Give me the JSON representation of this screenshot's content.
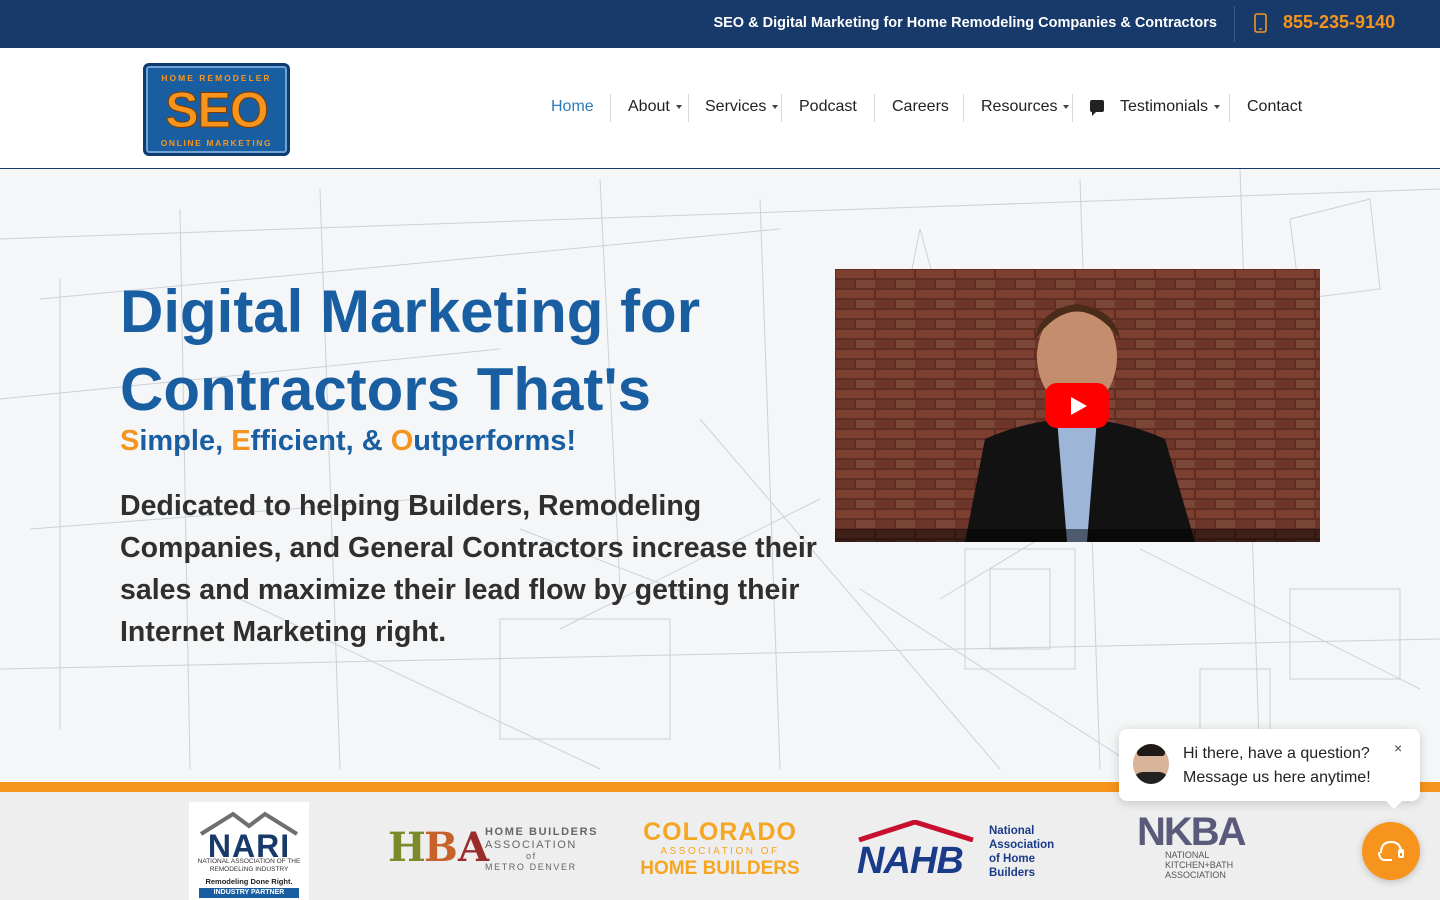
{
  "topbar": {
    "tagline": "SEO & Digital Marketing for Home Remodeling Companies & Contractors",
    "phone": "855-235-9140",
    "phone_icon": "mobile-phone-icon"
  },
  "logo": {
    "top_text": "HOME REMODELER",
    "big_text": "SEO",
    "bottom_text": "ONLINE MARKETING"
  },
  "nav": {
    "items": [
      {
        "label": "Home",
        "active": true,
        "dropdown": false
      },
      {
        "label": "About",
        "dropdown": true
      },
      {
        "label": "Services",
        "dropdown": true
      },
      {
        "label": "Podcast",
        "dropdown": false
      },
      {
        "label": "Careers",
        "dropdown": false
      },
      {
        "label": "Resources",
        "dropdown": true
      },
      {
        "label": "Testimonials",
        "dropdown": true,
        "icon": "chat-bubble-icon"
      },
      {
        "label": "Contact",
        "dropdown": false
      }
    ]
  },
  "hero": {
    "heading": "Digital Marketing for Contractors That's",
    "tagline_parts": [
      "S",
      "imple, ",
      "E",
      "fficient, & ",
      "O",
      "utperforms!"
    ],
    "description": "Dedicated to helping Builders, Remodeling Companies, and General Contractors increase their sales and maximize their lead flow by getting their Internet Marketing right."
  },
  "video": {
    "play_icon": "youtube-play-icon"
  },
  "partners": {
    "nari": {
      "word": "NARI",
      "sub": "NATIONAL ASSOCIATION OF THE REMODELING INDUSTRY",
      "slogan": "Remodeling Done Right.",
      "badge": "INDUSTRY PARTNER"
    },
    "hba": {
      "letters": [
        "H",
        "B",
        "A"
      ],
      "line1": "HOME BUILDERS",
      "line2": "ASSOCIATION",
      "line3": "of",
      "line4": "METRO DENVER"
    },
    "colorado": {
      "line1": "COLORADO",
      "line2": "ASSOCIATION OF",
      "line3": "HOME BUILDERS"
    },
    "nahb": {
      "word": "NAHB",
      "text": [
        "National",
        "Association",
        "of Home",
        "Builders"
      ]
    },
    "nkba": {
      "word": "NKBA",
      "text": [
        "NATIONAL",
        "KITCHEN+BATH",
        "ASSOCIATION"
      ]
    }
  },
  "chat": {
    "line1": "Hi there, have a question?",
    "line2": "Message us here anytime!",
    "close": "×"
  },
  "colors": {
    "navy": "#173a6a",
    "blue": "#1a5ea2",
    "orange": "#f7941d"
  }
}
